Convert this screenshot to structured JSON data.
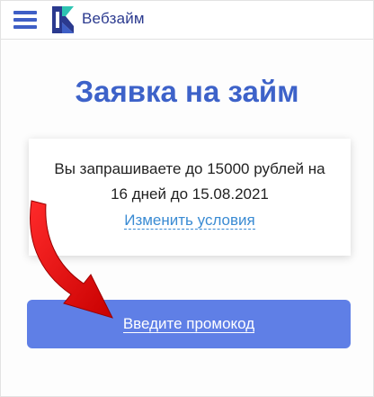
{
  "header": {
    "logo_text_part1": "Веб",
    "logo_text_part2": "займ",
    "menu_icon": "hamburger-menu-icon",
    "logo_icon": "webzaim-logo-icon"
  },
  "main": {
    "title": "Заявка на займ",
    "card": {
      "line1": "Вы запрашиваете до 15000 рублей на",
      "line2": "16 дней до 15.08.2021",
      "change_link": "Изменить условия"
    },
    "promo_button_label": "Введите промокод"
  },
  "colors": {
    "accent_blue": "#3d62c9",
    "button_blue": "#5f7fe6",
    "link_blue": "#3a8bd3",
    "arrow_red": "#e00000"
  }
}
